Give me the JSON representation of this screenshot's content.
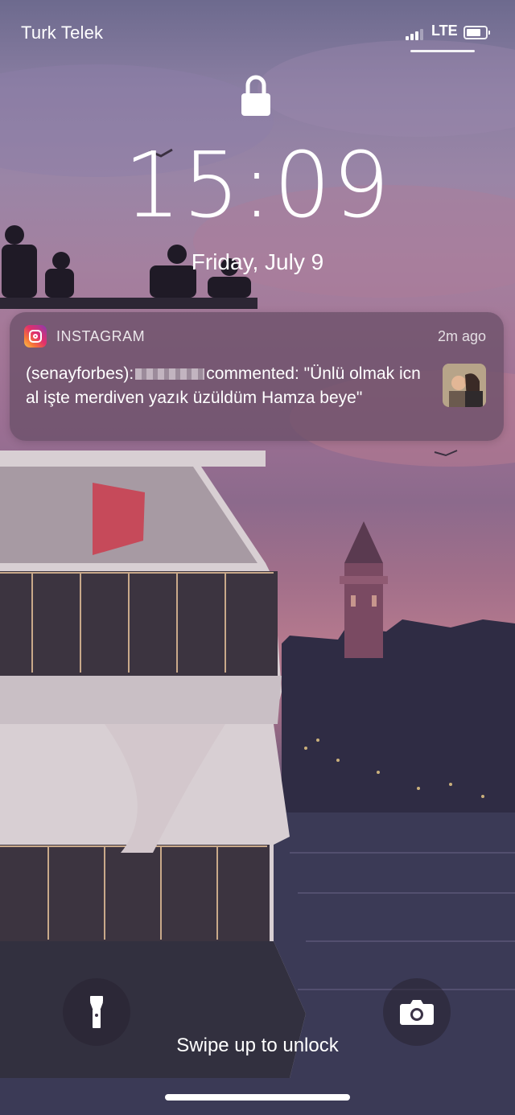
{
  "status_bar": {
    "carrier": "Turk Telek",
    "network": "LTE",
    "signal_bars": 3,
    "battery_level": 0.85
  },
  "lock_screen": {
    "lock_icon": "lock-icon",
    "time": "15:09",
    "date": "Friday, July 9"
  },
  "notification": {
    "app_icon": "instagram-icon",
    "app_name": "INSTAGRAM",
    "time_ago": "2m ago",
    "body_prefix": "(senayforbes):",
    "body_suffix": "commented: \"Ünlü olmak icn al işte merdiven yazık üzüldüm Hamza beye\""
  },
  "bottom": {
    "flashlight_icon": "flashlight-icon",
    "camera_icon": "camera-icon",
    "swipe_hint": "Swipe up to unlock"
  },
  "colors": {
    "text": "#ffffff",
    "notification_bg": "#684e66",
    "instagram_gradient": [
      "#f9c74f",
      "#f77737",
      "#e1306c",
      "#c13584",
      "#833ab4"
    ]
  }
}
